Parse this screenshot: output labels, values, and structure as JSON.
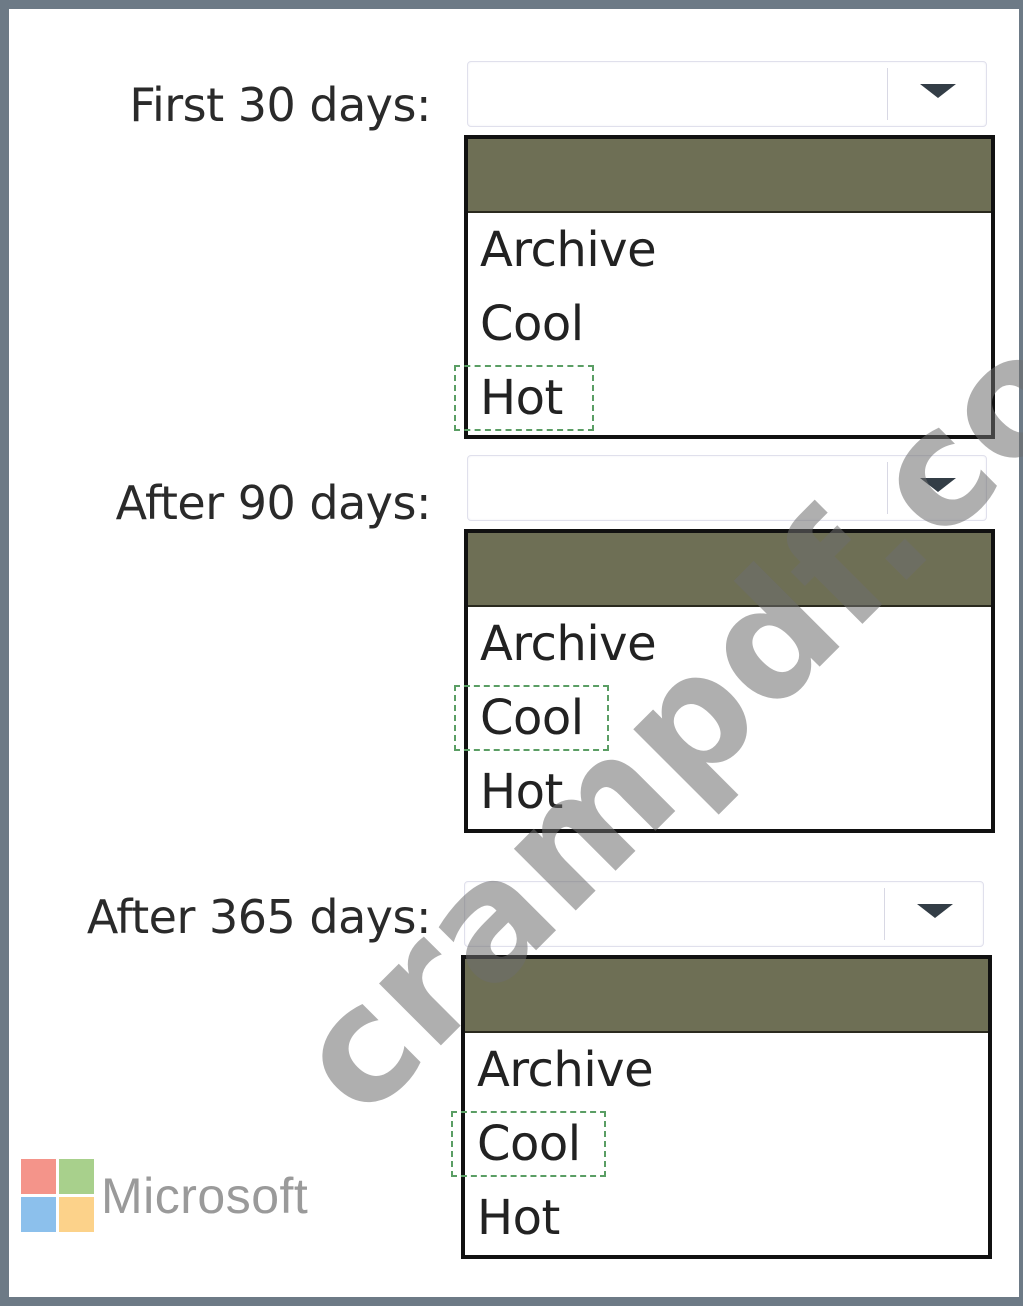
{
  "rows": [
    {
      "label": "First 30 days:",
      "selected_value": "",
      "options": [
        "",
        "Archive",
        "Cool",
        "Hot"
      ],
      "highlighted_option": "Hot"
    },
    {
      "label": "After 90 days:",
      "selected_value": "",
      "options": [
        "",
        "Archive",
        "Cool",
        "Hot"
      ],
      "highlighted_option": "Cool"
    },
    {
      "label": "After 365 days:",
      "selected_value": "",
      "options": [
        "",
        "Archive",
        "Cool",
        "Hot"
      ],
      "highlighted_option": "Cool"
    }
  ],
  "watermark": "crampdf.com",
  "branding": {
    "name": "Microsoft",
    "logo_icon": "microsoft-logo-icon"
  },
  "colors": {
    "frame": "#6d7a86",
    "blank_option": "#6e6f55",
    "highlight": "#5a9e64"
  }
}
